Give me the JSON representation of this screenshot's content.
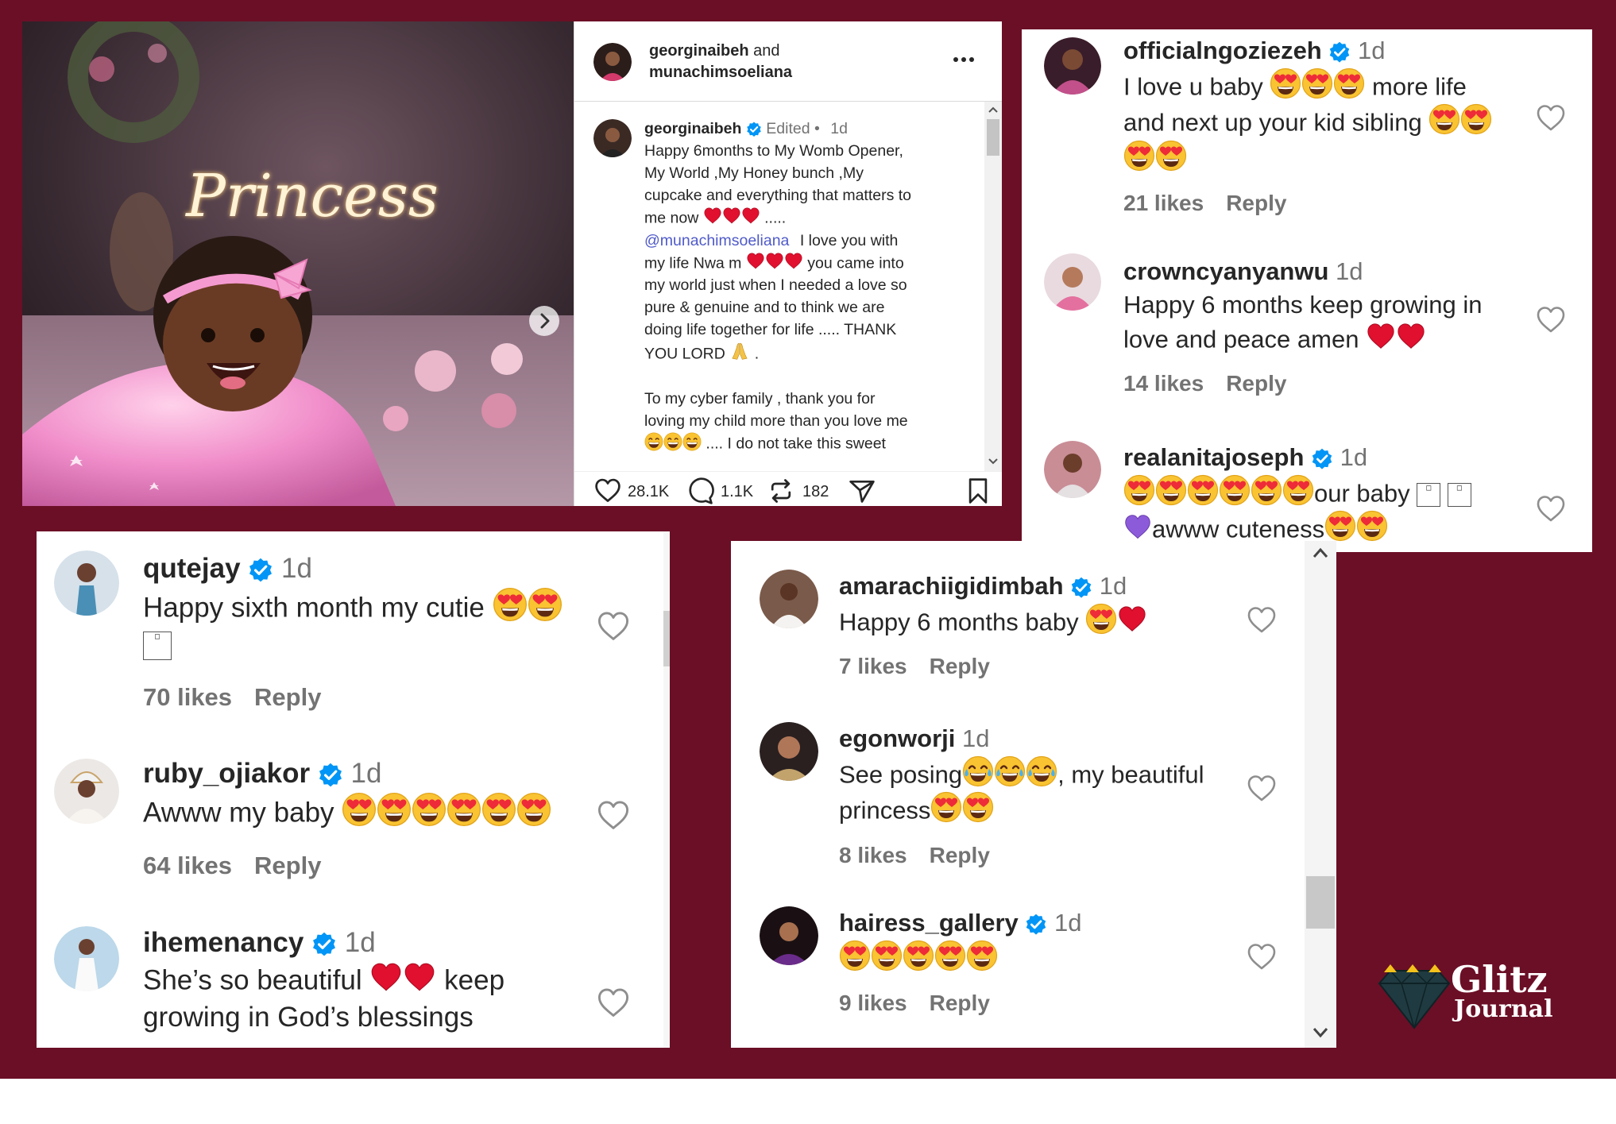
{
  "post": {
    "author1": "georginaibeh",
    "and_label": "and",
    "author2": "munachimsoeliana",
    "more": "...",
    "neon": "Princess",
    "caption_user": "georginaibeh",
    "caption_edited": "Edited •",
    "caption_age": "1d",
    "caption_l1": "Happy 6months to My Womb Opener,",
    "caption_l2": "My World ,My Honey bunch ,My",
    "caption_l3": "cupcake and everything that matters to",
    "caption_l4": "me now",
    "caption_l4b": ".....",
    "caption_mention": "@munachimsoeliana",
    "caption_l5b": "I love you with",
    "caption_l6": "my life Nwa m",
    "caption_l6b": "you came into",
    "caption_l7": "my world just when I needed a love so",
    "caption_l8": "pure & genuine and to think we are",
    "caption_l9": "doing life together for life ..... THANK",
    "caption_l10": "YOU LORD",
    "caption_l10b": ".",
    "caption_l11": "To my cyber family , thank you for",
    "caption_l12": "loving my child more than you love me",
    "caption_l13": ".... I do not take this sweet",
    "likes": "28.1K",
    "comments": "1.1K",
    "reposts": "182"
  },
  "panel_top_right": {
    "comments": [
      {
        "user": "officialngoziezeh",
        "age": "1d",
        "l1": "I love u baby",
        "l1b": "more life",
        "l2": "and next up your kid sibling",
        "likes": "21 likes",
        "reply": "Reply"
      },
      {
        "user": "crowncyanyanwu",
        "age": "1d",
        "l1": "Happy 6 months keep growing in",
        "l2": "love and peace amen",
        "likes": "14 likes",
        "reply": "Reply"
      },
      {
        "user": "realanitajoseph",
        "age": "1d",
        "l1b": "our baby",
        "l2b": "awww cuteness"
      }
    ]
  },
  "panel_bottom_left": {
    "comments": [
      {
        "user": "qutejay",
        "age": "1d",
        "text": "Happy sixth month my cutie",
        "likes": "70 likes",
        "reply": "Reply"
      },
      {
        "user": "ruby_ojiakor",
        "age": "1d",
        "text": "Awww my baby",
        "likes": "64 likes",
        "reply": "Reply"
      },
      {
        "user": "ihemenancy",
        "age": "1d",
        "l1": "She’s so beautiful",
        "l1b": "keep",
        "l2": "growing in God’s blessings"
      }
    ]
  },
  "panel_bottom_mid": {
    "comments": [
      {
        "user": "amarachiigidimbah",
        "age": "1d",
        "text": "Happy 6 months baby",
        "likes": "7 likes",
        "reply": "Reply"
      },
      {
        "user": "egonworji",
        "age": "1d",
        "l1a": "See posing",
        "l1b": ", my beautiful",
        "l2": "princess",
        "likes": "8 likes",
        "reply": "Reply"
      },
      {
        "user": "hairess_gallery",
        "age": "1d",
        "likes": "9 likes",
        "reply": "Reply"
      }
    ]
  },
  "logo": {
    "line1": "Glitz",
    "line2": "Journal"
  },
  "icons": [
    "verified-icon",
    "heart-icon",
    "comment-icon",
    "repost-icon",
    "share-icon",
    "bookmark-icon",
    "chevron-right-icon",
    "more-icon"
  ],
  "colors": {
    "background": "#6b0f26",
    "verified": "#0095f6",
    "heart_red": "#e0102e",
    "link": "#4f5ac9"
  }
}
